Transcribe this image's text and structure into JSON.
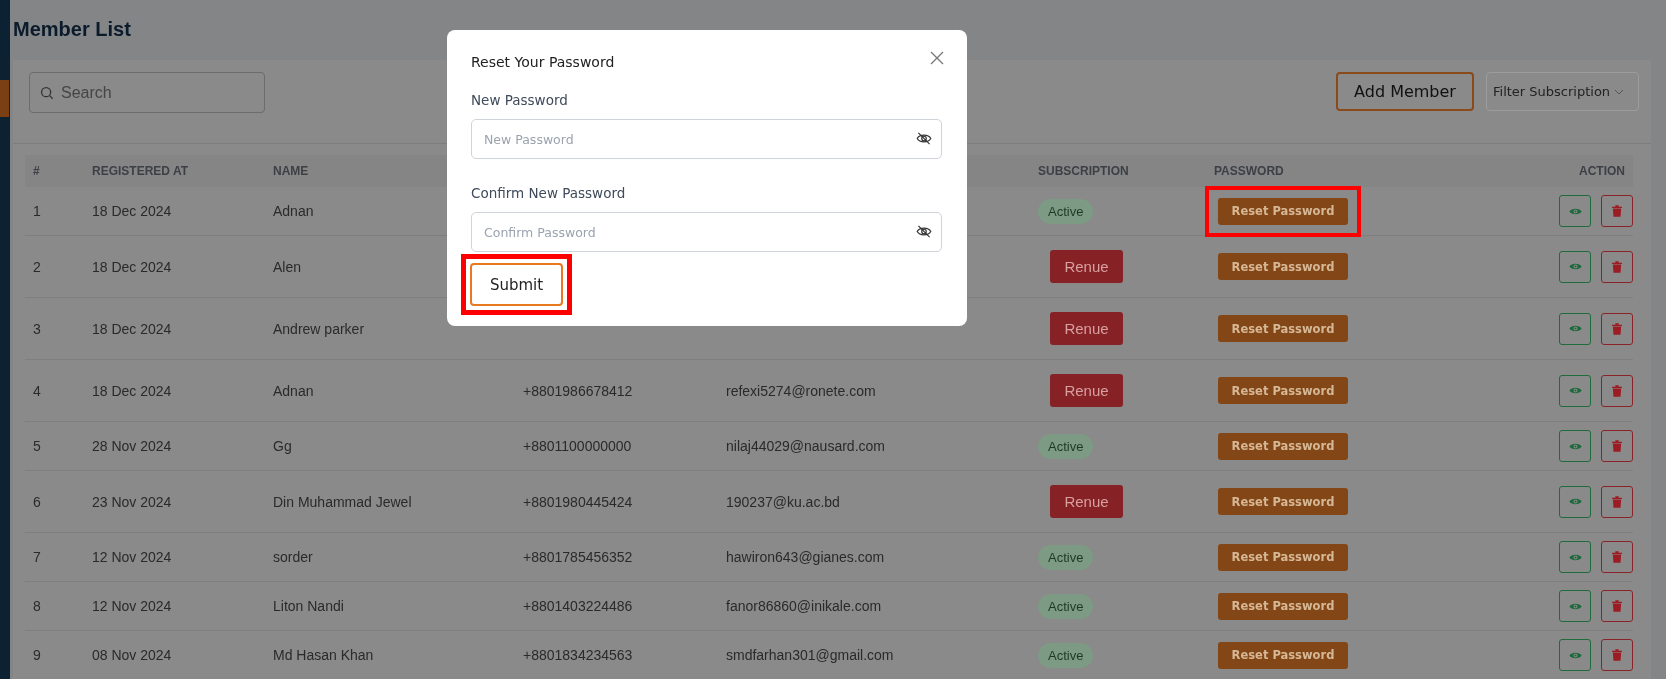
{
  "page": {
    "title": "Member List"
  },
  "toolbar": {
    "search": {
      "placeholder": "Search"
    },
    "add_button": "Add Member",
    "filter": {
      "label": "Filter Subscription"
    }
  },
  "table": {
    "columns": {
      "index": "#",
      "registered_at": "REGISTERED AT",
      "name": "NAME",
      "subscription": "SUBSCRIPTION",
      "password": "PASSWORD",
      "action": "ACTION"
    },
    "rows": [
      {
        "index": "1",
        "registered_at": "18 Dec 2024",
        "name": "Adnan",
        "subscription": {
          "kind": "badge",
          "label": "Active"
        },
        "password_button": "Reset Password",
        "highlighted": true
      },
      {
        "index": "2",
        "registered_at": "18 Dec 2024",
        "name": "Alen",
        "subscription": {
          "kind": "button",
          "label": "Renue"
        },
        "password_button": "Reset Password",
        "highlighted": false
      },
      {
        "index": "3",
        "registered_at": "18 Dec 2024",
        "name": "Andrew parker",
        "subscription": {
          "kind": "button",
          "label": "Renue"
        },
        "password_button": "Reset Password",
        "highlighted": false
      },
      {
        "index": "4",
        "registered_at": "18 Dec 2024",
        "name": "Adnan",
        "column_4": "+8801986678412",
        "column_5": "refexi5274@ronete.com",
        "subscription": {
          "kind": "button",
          "label": "Renue"
        },
        "password_button": "Reset Password",
        "highlighted": false
      },
      {
        "index": "5",
        "registered_at": "28 Nov 2024",
        "name": "Gg",
        "column_4": "+8801100000000",
        "column_5": "nilaj44029@nausard.com",
        "subscription": {
          "kind": "badge",
          "label": "Active"
        },
        "password_button": "Reset Password",
        "highlighted": false
      },
      {
        "index": "6",
        "registered_at": "23 Nov 2024",
        "name": "Din Muhammad Jewel",
        "column_4": "+8801980445424",
        "column_5": "190237@ku.ac.bd",
        "subscription": {
          "kind": "button",
          "label": "Renue"
        },
        "password_button": "Reset Password",
        "highlighted": false
      },
      {
        "index": "7",
        "registered_at": "12 Nov 2024",
        "name": "sorder",
        "column_4": "+8801785456352",
        "column_5": "hawiron643@gianes.com",
        "subscription": {
          "kind": "badge",
          "label": "Active"
        },
        "password_button": "Reset Password",
        "highlighted": false
      },
      {
        "index": "8",
        "registered_at": "12 Nov 2024",
        "name": "Liton Nandi",
        "column_4": "+8801403224486",
        "column_5": "fanor86860@inikale.com",
        "subscription": {
          "kind": "badge",
          "label": "Active"
        },
        "password_button": "Reset Password",
        "highlighted": false
      },
      {
        "index": "9",
        "registered_at": "08 Nov 2024",
        "name": "Md Hasan Khan",
        "column_4": "+8801834234563",
        "column_5": "smdfarhan301@gmail.com",
        "subscription": {
          "kind": "badge",
          "label": "Active"
        },
        "password_button": "Reset Password",
        "highlighted": false
      }
    ]
  },
  "modal": {
    "title": "Reset Your Password",
    "fields": [
      {
        "label": "New Password",
        "placeholder": "New Password"
      },
      {
        "label": "Confirm New Password",
        "placeholder": "Confirm Password"
      }
    ],
    "submit": "Submit",
    "submit_highlighted": true
  }
}
